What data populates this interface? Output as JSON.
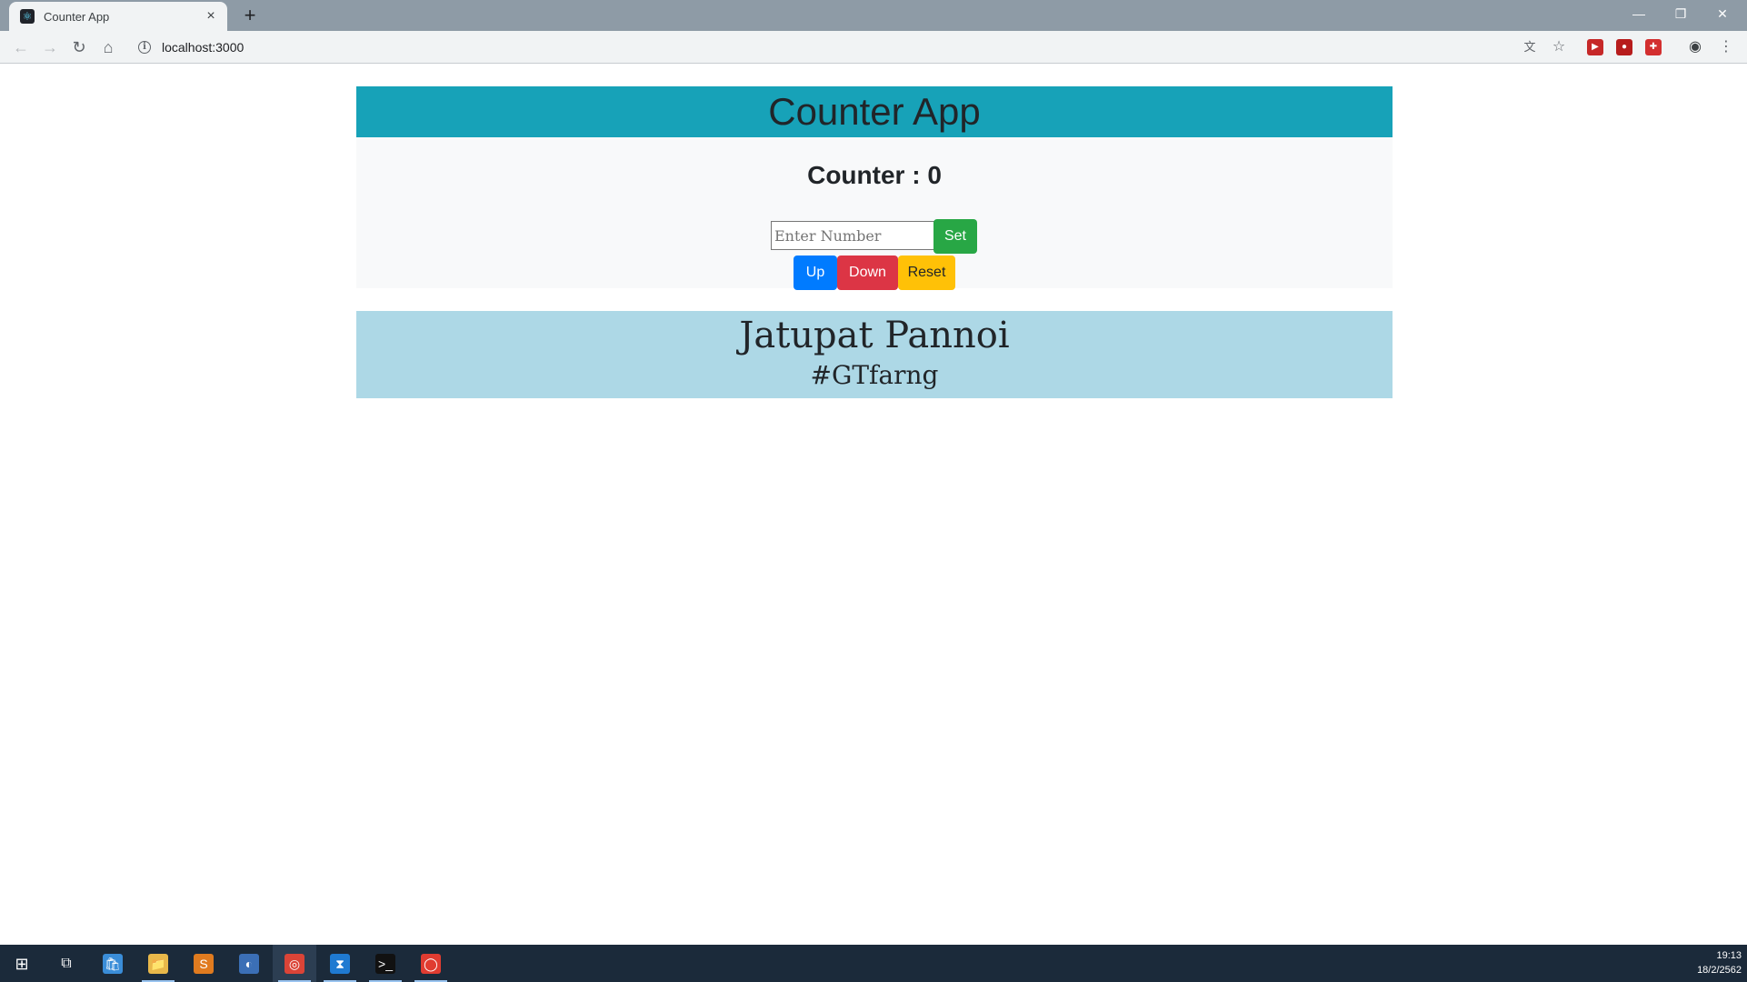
{
  "browser": {
    "tab_title": "Counter App",
    "tab_close": "×",
    "new_tab": "+",
    "window_minimize": "—",
    "window_restore": "❐",
    "window_close": "✕",
    "back": "←",
    "forward": "→",
    "reload": "↻",
    "home": "⌂",
    "info": "i",
    "url": "localhost:3000",
    "translate": "文",
    "bookmark": "☆",
    "menu": "⋮",
    "extensions": [
      {
        "name": "extension-a",
        "glyph": "▶",
        "color": "#c62828"
      },
      {
        "name": "extension-b",
        "glyph": "●",
        "color": "#b71c1c"
      },
      {
        "name": "extension-c",
        "glyph": "✚",
        "color": "#d32f2f"
      }
    ],
    "profile": "◉"
  },
  "app": {
    "title": "Counter App",
    "counter_text": "Counter : 0",
    "input_placeholder": "Enter Number",
    "set_label": "Set",
    "up_label": "Up",
    "down_label": "Down",
    "reset_label": "Reset",
    "author_name": "Jatupat Pannoi",
    "author_tag": "#GTfarng"
  },
  "colors": {
    "header": "#17a2b8",
    "panel": "#f8f9fa",
    "author_panel": "#add8e6",
    "set": "#28a745",
    "up": "#007bff",
    "down": "#dc3545",
    "reset": "#ffc107"
  },
  "taskbar": {
    "start": "⊞",
    "task_view": "⧉",
    "apps": [
      {
        "name": "store",
        "glyph": "🛍",
        "bg": "#3a8dd8"
      },
      {
        "name": "file-explorer",
        "glyph": "📁",
        "bg": "#e8b84a"
      },
      {
        "name": "sublime-text",
        "glyph": "S",
        "bg": "#e07b1f"
      },
      {
        "name": "mysql-workbench",
        "glyph": "◐",
        "bg": "#3b6fb6"
      },
      {
        "name": "chrome",
        "glyph": "◎",
        "bg": "#db4437"
      },
      {
        "name": "vscode",
        "glyph": "⧗",
        "bg": "#1f7ad1"
      },
      {
        "name": "terminal",
        "glyph": ">_",
        "bg": "#111111"
      },
      {
        "name": "app-ring",
        "glyph": "◯",
        "bg": "#e03c31"
      }
    ],
    "clock_time": "19:13",
    "clock_date": "18/2/2562"
  }
}
